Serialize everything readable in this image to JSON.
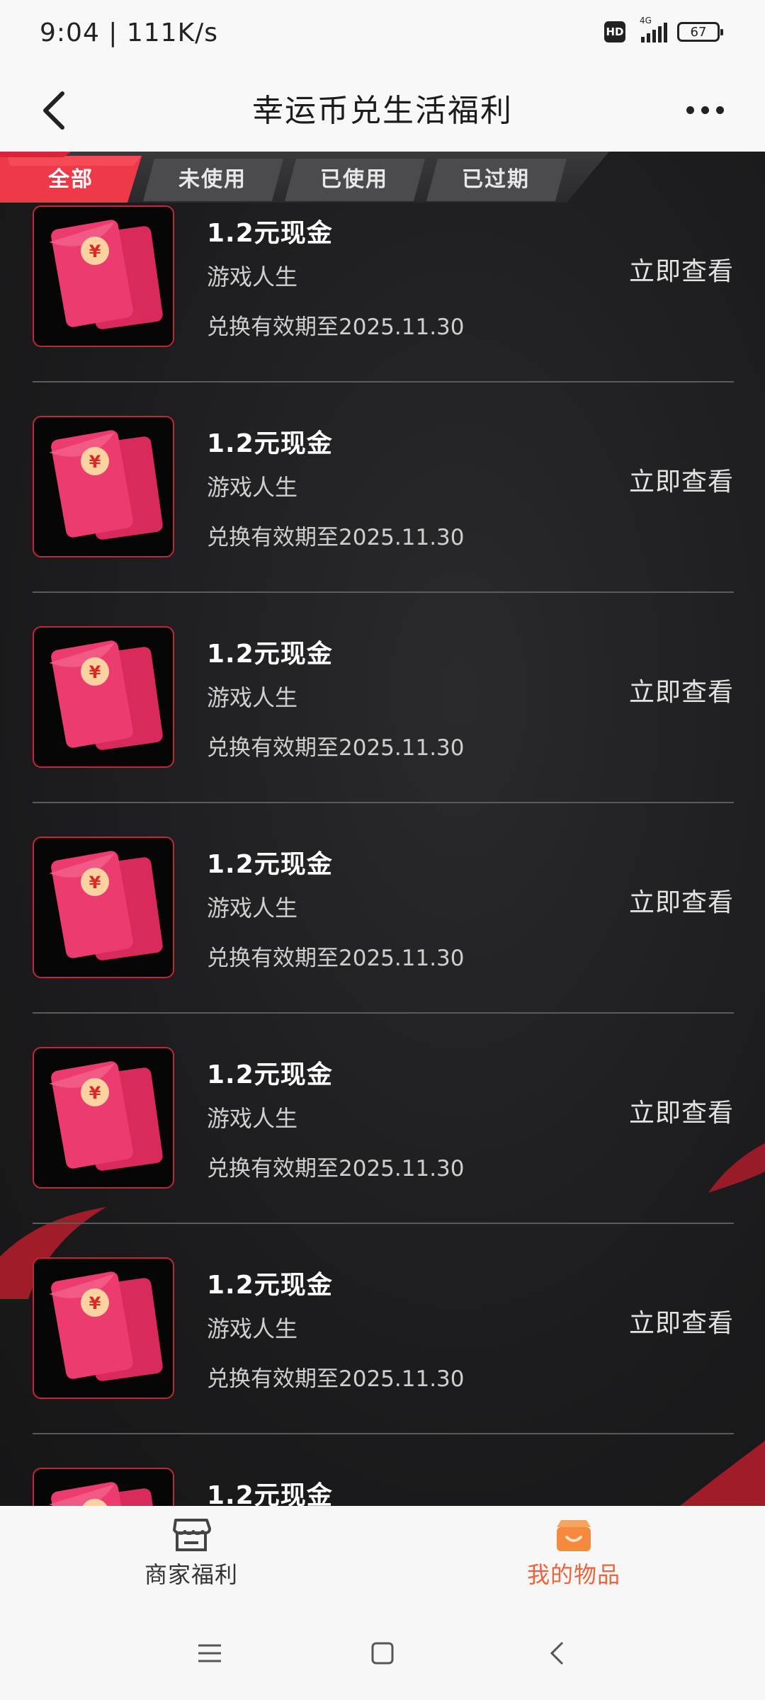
{
  "status_bar": {
    "time": "9:04 | 111K/s",
    "hd": "HD",
    "network": "4G",
    "battery": "67"
  },
  "header": {
    "title": "幸运币兑生活福利"
  },
  "tabs": [
    {
      "label": "全部",
      "active": true
    },
    {
      "label": "未使用",
      "active": false
    },
    {
      "label": "已使用",
      "active": false
    },
    {
      "label": "已过期",
      "active": false
    }
  ],
  "items": [
    {
      "title": "1.2元现金",
      "subtitle": "游戏人生",
      "validity": "兑换有效期至2025.11.30",
      "action": "立即查看"
    },
    {
      "title": "1.2元现金",
      "subtitle": "游戏人生",
      "validity": "兑换有效期至2025.11.30",
      "action": "立即查看"
    },
    {
      "title": "1.2元现金",
      "subtitle": "游戏人生",
      "validity": "兑换有效期至2025.11.30",
      "action": "立即查看"
    },
    {
      "title": "1.2元现金",
      "subtitle": "游戏人生",
      "validity": "兑换有效期至2025.11.30",
      "action": "立即查看"
    },
    {
      "title": "1.2元现金",
      "subtitle": "游戏人生",
      "validity": "兑换有效期至2025.11.30",
      "action": "立即查看"
    },
    {
      "title": "1.2元现金",
      "subtitle": "游戏人生",
      "validity": "兑换有效期至2025.11.30",
      "action": "立即查看"
    },
    {
      "title": "1.2元现金",
      "subtitle": "",
      "validity": "",
      "action": ""
    }
  ],
  "bottom_nav": [
    {
      "label": "商家福利",
      "icon": "shop-icon",
      "active": false
    },
    {
      "label": "我的物品",
      "icon": "gift-box-icon",
      "active": true
    }
  ],
  "colors": {
    "accent": "#f0643c",
    "card_border": "#c0283a",
    "active_tab": "#ee3a48",
    "red_packet": "#e8306a"
  }
}
